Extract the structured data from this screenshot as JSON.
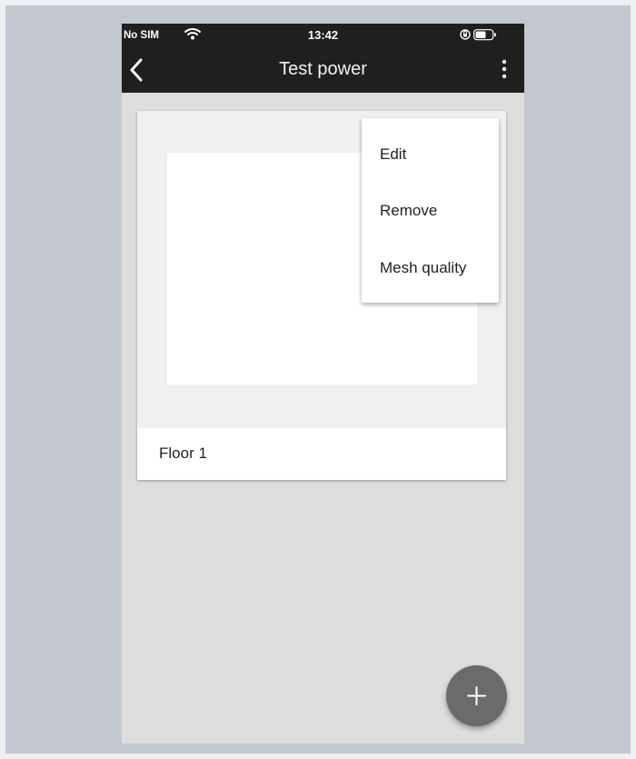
{
  "status_bar": {
    "carrier": "No SIM",
    "time": "13:42",
    "icons": [
      "wifi-icon",
      "orientation-lock-icon",
      "battery-icon"
    ]
  },
  "app_bar": {
    "title": "Test power",
    "back_icon": "chevron-left-icon",
    "more_icon": "more-vertical-icon"
  },
  "floors": [
    {
      "label": "Floor 1"
    }
  ],
  "context_menu": {
    "items": [
      {
        "label": "Edit"
      },
      {
        "label": "Remove"
      },
      {
        "label": "Mesh quality"
      }
    ]
  },
  "fab": {
    "icon": "plus-icon"
  },
  "colors": {
    "app_bar": "#1f1f1f",
    "background": "#dedede",
    "card": "#f0f0f0",
    "fab": "#6b6b6b"
  }
}
